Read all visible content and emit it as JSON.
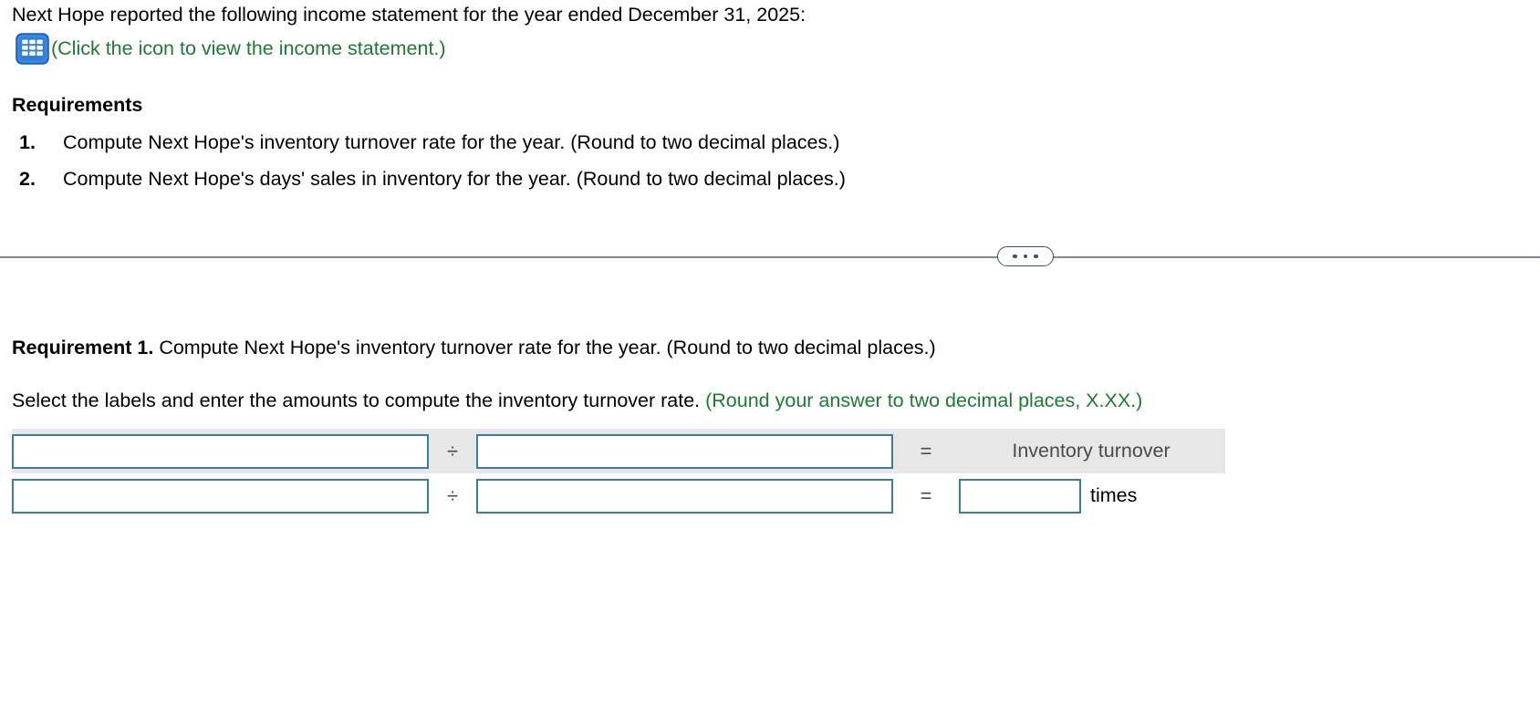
{
  "intro": {
    "sentence": "Next Hope reported the following income statement for the year ended December 31, 2025:",
    "icon_name": "spreadsheet-icon",
    "icon_caption": "(Click the icon to view the income statement.)",
    "caption_color": "#1d7a33"
  },
  "requirements": {
    "heading": "Requirements",
    "items": [
      {
        "number": "1.",
        "text": "Compute Next Hope's inventory turnover rate for the year. (Round to two decimal places.)"
      },
      {
        "number": "2.",
        "text": "Compute Next Hope's days' sales in inventory for the year. (Round to two decimal places.)"
      }
    ]
  },
  "divider": {
    "ellipsis_label": "...",
    "dot_count": 3
  },
  "requirement1": {
    "label": "Requirement 1.",
    "prompt": "Compute Next Hope's inventory turnover rate for the year. (Round to two decimal places.)",
    "instruction": "Select the labels and enter the amounts to compute the inventory turnover rate.",
    "instruction_note": "(Round your answer to two decimal places, X.XX.)",
    "note_color": "#1d7a33"
  },
  "formula": {
    "operator": "÷",
    "equals": "=",
    "rows": [
      {
        "numerator_value": "",
        "numerator_placeholder": "",
        "denominator_value": "",
        "denominator_placeholder": "",
        "result_label": "Inventory turnover",
        "shaded": true
      },
      {
        "numerator_value": "",
        "numerator_placeholder": "",
        "denominator_value": "",
        "denominator_placeholder": "",
        "answer_value": "",
        "answer_placeholder": "",
        "unit_label": "times",
        "shaded": false
      }
    ]
  },
  "colors": {
    "input_border": "#3b7f96",
    "shaded_row": "#e7e7e7",
    "icon_blue": "#1f6fd0",
    "divider": "#7b8794"
  }
}
